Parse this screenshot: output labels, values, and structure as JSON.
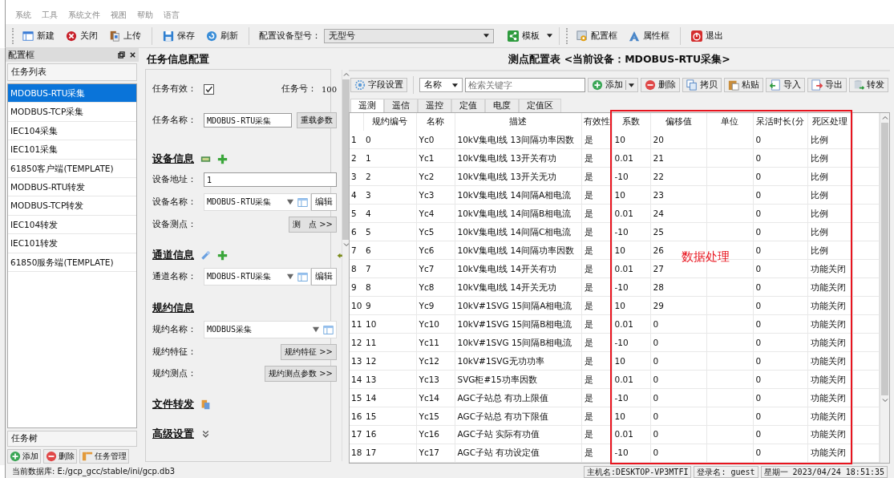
{
  "menu": [
    "系统",
    "工具",
    "系统文件",
    "视图",
    "帮助",
    "语言"
  ],
  "toolbar": {
    "groups": [
      [
        {
          "label": "新建"
        },
        {
          "label": "关闭"
        },
        {
          "label": "上传"
        }
      ],
      [
        {
          "label": "保存"
        },
        {
          "label": "刷新"
        }
      ]
    ],
    "device_type_label": "配置设备型号：",
    "device_type": "无型号",
    "template": "模板",
    "right": [
      [
        {
          "label": "配置框"
        },
        {
          "label": "属性框"
        }
      ],
      [
        {
          "label": "退出"
        }
      ]
    ]
  },
  "config_dock": {
    "title": "配置框",
    "list_title": "任务列表",
    "tasks": [
      {
        "label": "MDOBUS-RTU采集",
        "selected": true
      },
      {
        "label": "MODBUS-TCP采集",
        "selected": false
      },
      {
        "label": "IEC104采集",
        "selected": false
      },
      {
        "label": "IEC101采集",
        "selected": false
      },
      {
        "label": "61850客户端(TEMPLATE)",
        "selected": false
      },
      {
        "label": "MODBUS-RTU转发",
        "selected": false
      },
      {
        "label": "MODBUS-TCP转发",
        "selected": false
      },
      {
        "label": "IEC104转发",
        "selected": false
      },
      {
        "label": "IEC101转发",
        "selected": false
      },
      {
        "label": "61850服务端(TEMPLATE)",
        "selected": false
      }
    ],
    "tree_tab": "任务树",
    "buttons": [
      {
        "label": "添加"
      },
      {
        "label": "删除"
      },
      {
        "label": "任务管理"
      }
    ]
  },
  "task_form": {
    "title": "任务信息配置",
    "enabled_label": "任务有效：",
    "enabled": true,
    "task_no_label": "任务号：",
    "task_no": "100",
    "name_label": "任务名称：",
    "name": "MDOBUS-RTU采集",
    "reload_button": "重载参数",
    "sections": [
      {
        "heading": "设备信息",
        "rows": [
          {
            "kind": "input",
            "label": "设备地址：",
            "value": "1"
          },
          {
            "kind": "combo",
            "label": "设备名称：",
            "value": "MDOBUS-RTU采集",
            "button": "编辑"
          },
          {
            "kind": "button",
            "label": "设备测点：",
            "button": "测　点 >>"
          }
        ]
      },
      {
        "heading": "通道信息",
        "rows": [
          {
            "kind": "combo",
            "label": "通道名称：",
            "value": "MDOBUS-RTU采集",
            "button": "编辑"
          }
        ]
      },
      {
        "heading": "规约信息",
        "rows": [
          {
            "kind": "combo",
            "label": "规约名称：",
            "value": "MODBUS采集"
          },
          {
            "kind": "button",
            "label": "规约特征：",
            "button": "规约特征 >>"
          },
          {
            "kind": "button",
            "label": "规约测点：",
            "button": "规约测点参数 >>"
          }
        ]
      },
      {
        "heading": "文件转发"
      },
      {
        "heading": "高级设置"
      }
    ]
  },
  "points_table": {
    "title": "测点配置表 <当前设备：MDOBUS-RTU采集>",
    "field_settings": "字段设置",
    "field_select": "名称",
    "search_placeholder": "检索关键字",
    "buttons": [
      {
        "label": "添加"
      },
      {
        "label": "删除"
      },
      {
        "label": "拷贝"
      },
      {
        "label": "粘贴"
      },
      {
        "label": "导入"
      },
      {
        "label": "导出"
      },
      {
        "label": "转发"
      }
    ],
    "tabs": [
      {
        "label": "遥测",
        "selected": true
      },
      {
        "label": "遥信",
        "selected": false
      },
      {
        "label": "遥控",
        "selected": false
      },
      {
        "label": "定值",
        "selected": false
      },
      {
        "label": "电度",
        "selected": false
      },
      {
        "label": "定值区",
        "selected": false
      }
    ],
    "columns": [
      {
        "label": "规约编号",
        "highlighted": false
      },
      {
        "label": "名称",
        "highlighted": false
      },
      {
        "label": "描述",
        "highlighted": false
      },
      {
        "label": "有效性",
        "highlighted": false
      },
      {
        "label": "系数",
        "highlighted": true
      },
      {
        "label": "偏移值",
        "highlighted": true
      },
      {
        "label": "单位",
        "highlighted": true
      },
      {
        "label": "呆活时长(分",
        "highlighted": true
      },
      {
        "label": "死区处理",
        "highlighted": true
      }
    ],
    "annotation": "数据处理",
    "rows": [
      {
        "no": "1",
        "cells": [
          "0",
          "Yc0",
          "10kV集电I线 13间隔功率因数",
          "是",
          "10",
          "20",
          "",
          "0",
          "比例"
        ]
      },
      {
        "no": "2",
        "cells": [
          "1",
          "Yc1",
          "10kV集电I线 13开关有功",
          "是",
          "0.01",
          "21",
          "",
          "0",
          "比例"
        ]
      },
      {
        "no": "3",
        "cells": [
          "2",
          "Yc2",
          "10kV集电I线 13开关无功",
          "是",
          "-10",
          "22",
          "",
          "0",
          "比例"
        ]
      },
      {
        "no": "4",
        "cells": [
          "3",
          "Yc3",
          "10kV集电I线 14间隔A相电流",
          "是",
          "10",
          "23",
          "",
          "0",
          "比例"
        ]
      },
      {
        "no": "5",
        "cells": [
          "4",
          "Yc4",
          "10kV集电I线 14间隔B相电流",
          "是",
          "0.01",
          "24",
          "",
          "0",
          "比例"
        ]
      },
      {
        "no": "6",
        "cells": [
          "5",
          "Yc5",
          "10kV集电I线 14间隔C相电流",
          "是",
          "-10",
          "25",
          "",
          "0",
          "比例"
        ]
      },
      {
        "no": "7",
        "cells": [
          "6",
          "Yc6",
          "10kV集电I线 14间隔功率因数",
          "是",
          "10",
          "26",
          "",
          "0",
          "比例"
        ]
      },
      {
        "no": "8",
        "cells": [
          "7",
          "Yc7",
          "10kV集电I线 14开关有功",
          "是",
          "0.01",
          "27",
          "",
          "0",
          "功能关闭"
        ]
      },
      {
        "no": "9",
        "cells": [
          "8",
          "Yc8",
          "10kV集电I线 14开关无功",
          "是",
          "-10",
          "28",
          "",
          "0",
          "功能关闭"
        ]
      },
      {
        "no": "10",
        "cells": [
          "9",
          "Yc9",
          "10kV#1SVG 15间隔A相电流",
          "是",
          "10",
          "29",
          "",
          "0",
          "功能关闭"
        ]
      },
      {
        "no": "11",
        "cells": [
          "10",
          "Yc10",
          "10kV#1SVG 15间隔B相电流",
          "是",
          "0.01",
          "0",
          "",
          "0",
          "功能关闭"
        ]
      },
      {
        "no": "12",
        "cells": [
          "11",
          "Yc11",
          "10kV#1SVG 15间隔B相电流",
          "是",
          "-10",
          "0",
          "",
          "0",
          "功能关闭"
        ]
      },
      {
        "no": "13",
        "cells": [
          "12",
          "Yc12",
          "10kV#1SVG无功功率",
          "是",
          "10",
          "0",
          "",
          "0",
          "功能关闭"
        ]
      },
      {
        "no": "14",
        "cells": [
          "13",
          "Yc13",
          "SVG柜#15功率因数",
          "是",
          "0.01",
          "0",
          "",
          "0",
          "功能关闭"
        ]
      },
      {
        "no": "15",
        "cells": [
          "14",
          "Yc14",
          "AGC子站总 有功上限值",
          "是",
          "-10",
          "0",
          "",
          "0",
          "功能关闭"
        ]
      },
      {
        "no": "16",
        "cells": [
          "15",
          "Yc15",
          "AGC子站总 有功下限值",
          "是",
          "10",
          "0",
          "",
          "0",
          "功能关闭"
        ]
      },
      {
        "no": "17",
        "cells": [
          "16",
          "Yc16",
          "AGC子站 实际有功值",
          "是",
          "0.01",
          "0",
          "",
          "0",
          "功能关闭"
        ]
      },
      {
        "no": "18",
        "cells": [
          "17",
          "Yc17",
          "AGC子站 有功设定值",
          "是",
          "-10",
          "0",
          "",
          "0",
          "功能关闭"
        ]
      }
    ]
  },
  "status_bar": {
    "database": "当前数据库:  E:/gcp_gcc/stable/ini/gcp.db3",
    "host": "主机名:DESKTOP-VP3MTFI",
    "login": "登录名:  guest",
    "datetime": "星期一  2023/04/24 18:51:35"
  }
}
